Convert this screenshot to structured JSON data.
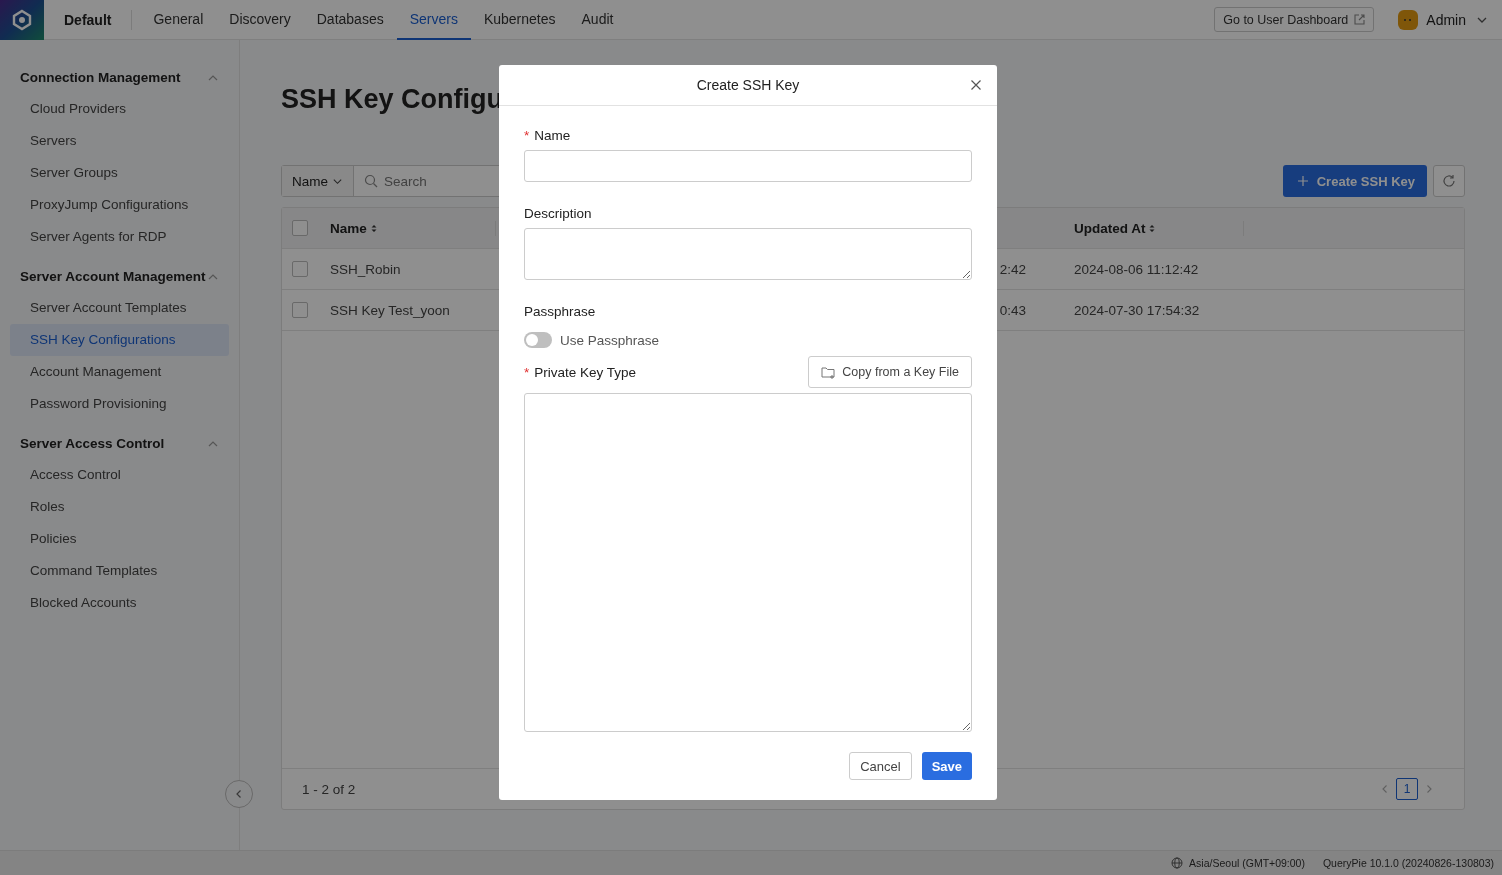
{
  "header": {
    "workspace": "Default",
    "tabs": [
      {
        "label": "General",
        "selected": false
      },
      {
        "label": "Discovery",
        "selected": false
      },
      {
        "label": "Databases",
        "selected": false
      },
      {
        "label": "Servers",
        "selected": true
      },
      {
        "label": "Kubernetes",
        "selected": false
      },
      {
        "label": "Audit",
        "selected": false
      }
    ],
    "dashboard_button": "Go to User Dashboard",
    "user": "Admin"
  },
  "sidebar": {
    "groups": [
      {
        "title": "Connection Management",
        "expanded": true,
        "items": [
          {
            "label": "Cloud Providers",
            "selected": false
          },
          {
            "label": "Servers",
            "selected": false
          },
          {
            "label": "Server Groups",
            "selected": false
          },
          {
            "label": "ProxyJump Configurations",
            "selected": false
          },
          {
            "label": "Server Agents for RDP",
            "selected": false
          }
        ]
      },
      {
        "title": "Server Account Management",
        "expanded": true,
        "items": [
          {
            "label": "Server Account Templates",
            "selected": false
          },
          {
            "label": "SSH Key Configurations",
            "selected": true
          },
          {
            "label": "Account Management",
            "selected": false
          },
          {
            "label": "Password Provisioning",
            "selected": false
          }
        ]
      },
      {
        "title": "Server Access Control",
        "expanded": true,
        "items": [
          {
            "label": "Access Control",
            "selected": false
          },
          {
            "label": "Roles",
            "selected": false
          },
          {
            "label": "Policies",
            "selected": false
          },
          {
            "label": "Command Templates",
            "selected": false
          },
          {
            "label": "Blocked Accounts",
            "selected": false
          }
        ]
      }
    ]
  },
  "page": {
    "title": "SSH Key Configu",
    "filter": "Name",
    "search": {
      "placeholder": "Search"
    },
    "create_button": "Create SSH Key",
    "table": {
      "all_checked": false,
      "columns": [
        "Name",
        "Updated At"
      ],
      "rows": [
        {
          "checked": false,
          "name": "SSH_Robin",
          "column_3": "2:42",
          "updated_at": "2024-08-06 11:12:42"
        },
        {
          "checked": false,
          "name": "SSH Key Test_yoon",
          "column_3": "0:43",
          "updated_at": "2024-07-30 17:54:32"
        }
      ]
    },
    "range": "1 - 2 of 2",
    "pages": [
      {
        "label": "1",
        "selected": true
      }
    ]
  },
  "dialog": {
    "title": "Create SSH Key",
    "name": {
      "required_mark": "*",
      "label": "Name"
    },
    "description": {
      "label": "Description"
    },
    "passphrase": {
      "label": "Passphrase",
      "toggle_label": "Use Passphrase",
      "on": false
    },
    "private_key": {
      "required_mark": "*",
      "label": "Private Key Type",
      "copy_button": "Copy from a Key File"
    },
    "buttons": {
      "cancel": "Cancel",
      "save": "Save"
    }
  },
  "status_bar": {
    "timezone": "Asia/Seoul (GMT+09:00)",
    "version": "QueryPie 10.1.0 (20240826-130803)"
  }
}
